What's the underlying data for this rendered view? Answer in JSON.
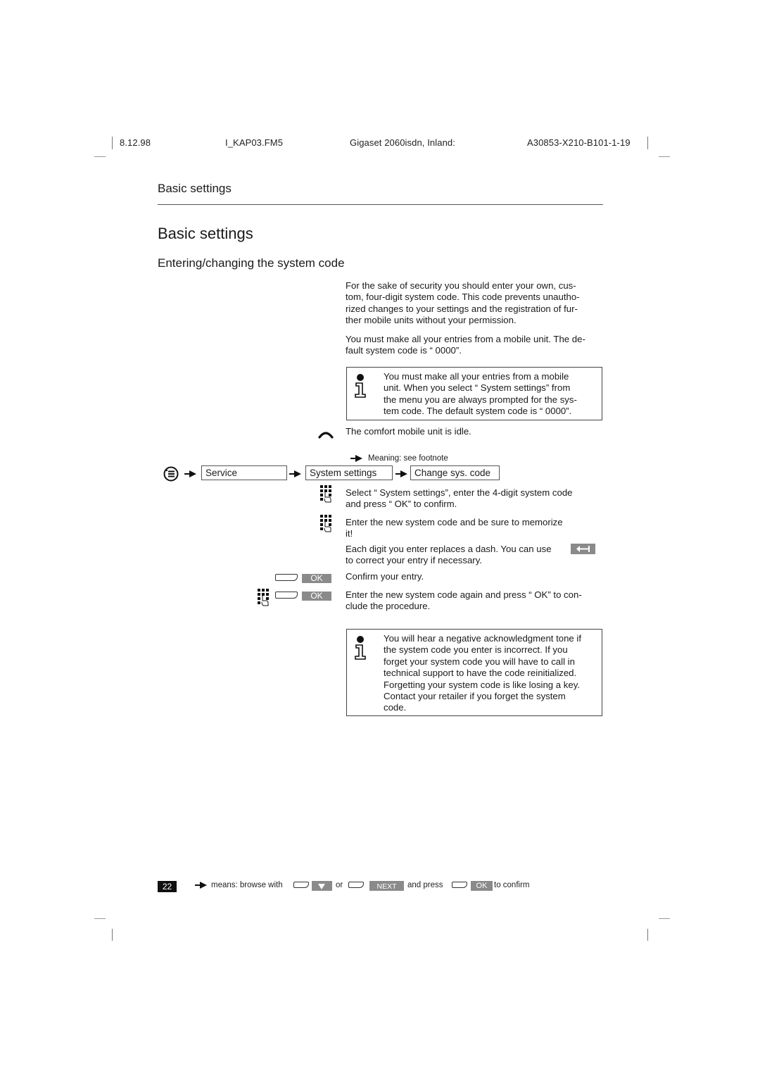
{
  "header": {
    "date": "8.12.98",
    "file": "I_KAP03.FM5",
    "product": "Gigaset 2060isdn, Inland:",
    "doc_number": "A30853-X210-B101-1-19"
  },
  "section_title": "Basic settings",
  "page_title": "Basic settings",
  "subtitle": "Entering/changing the system code",
  "intro": {
    "paragraph1": [
      "For the sake of security you should enter your own, cus-",
      "tom, four-digit system code. This code prevents unautho-",
      "rized changes to your settings and the registration of fur-",
      "ther mobile units without your permission."
    ],
    "paragraph2": [
      "You must make all your entries from a mobile unit. The de-",
      "fault system code is “ 0000”."
    ]
  },
  "note1": {
    "icon": "info-icon",
    "lines": [
      "You must make all your entries from a mobile",
      "unit. When you select “ System settings”  from",
      "the menu you are always prompted for the sys-",
      "tem code. The default system code is “ 0000”."
    ]
  },
  "idle_step": {
    "icon": "handset-icon",
    "text": "The comfort mobile unit is idle."
  },
  "footnote_hint": {
    "icon": "double-arrow-icon",
    "text": "Meaning: see footnote"
  },
  "nav_path": {
    "icon": "menu-icon",
    "items": [
      "Service",
      "System settings",
      "Change sys. code"
    ]
  },
  "steps": [
    {
      "icon": "keypad-icon",
      "lines": [
        "Select “ System settings”, enter the 4-digit system code",
        "and press “ OK”  to confirm."
      ]
    },
    {
      "icon": "keypad-icon",
      "lines": [
        "Enter the new system code and be sure to memorize",
        "it!"
      ]
    },
    {
      "icon": "backspace-key",
      "lines": [
        "Each digit you enter replaces a dash. You can use",
        "to correct your entry if necessary."
      ]
    },
    {
      "icon": "ok-softkey",
      "key_label": "OK",
      "lines": [
        "Confirm your entry."
      ]
    },
    {
      "icon": "keypad-ok-softkey",
      "key_label": "OK",
      "lines": [
        "Enter the new system code again and press “ OK”  to con-",
        "clude the procedure."
      ]
    }
  ],
  "note2": {
    "icon": "info-icon",
    "lines": [
      "You will hear a negative acknowledgment tone if",
      "the system code you enter is incorrect. If you",
      "forget your system code you will have to call in",
      "technical support to have the code reinitialized.",
      "Forgetting your system code is like losing a key.",
      "Contact your retailer if you forget the system",
      "code."
    ]
  },
  "footer": {
    "page_number": "22",
    "text_means": "means: browse with",
    "text_or": "or",
    "next_label": "NEXT",
    "text_and_press": "and press",
    "ok_label": "OK",
    "text_confirm": "to confirm"
  },
  "colors": {
    "key_gray": "#8a8a8a",
    "text": "#1a1a1a",
    "page_number_bg": "#111111"
  }
}
